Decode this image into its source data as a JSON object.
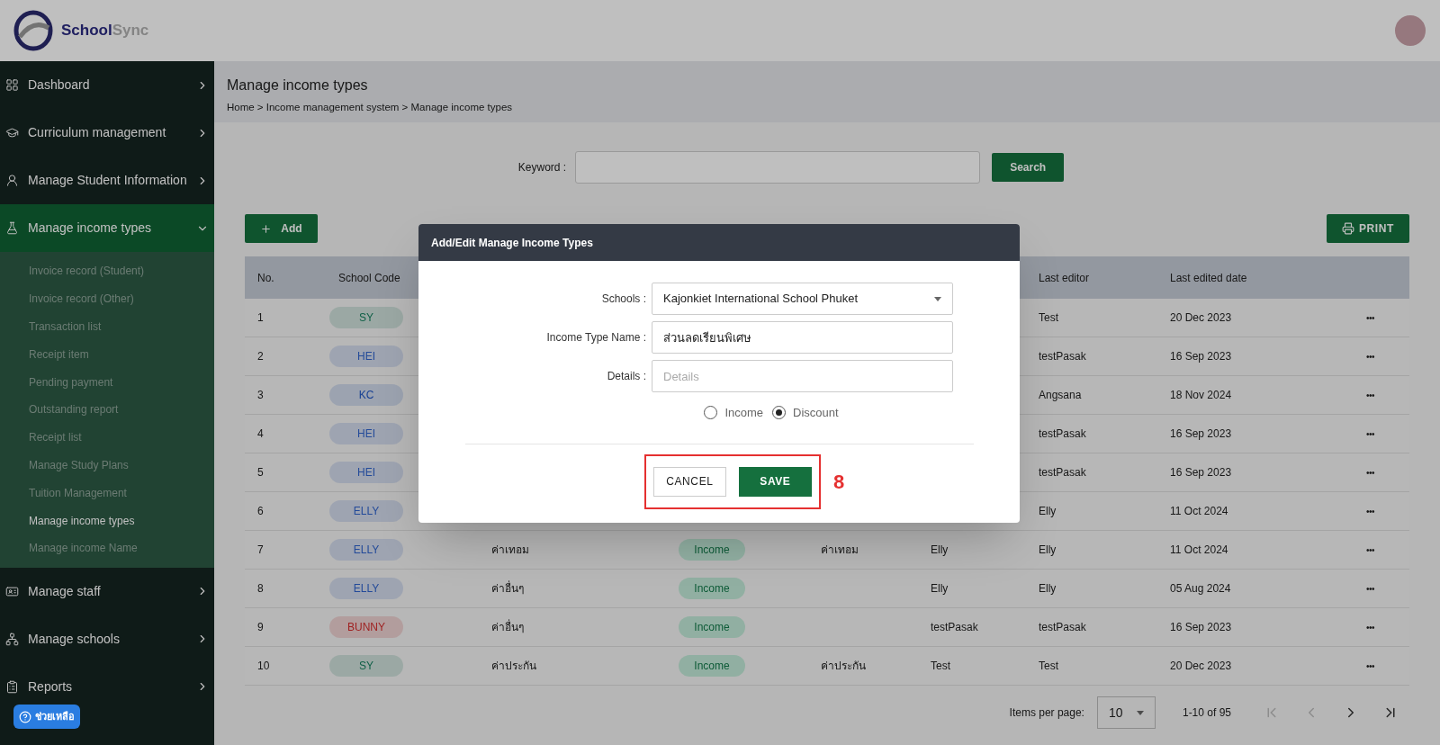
{
  "brand": {
    "first": "School",
    "second": "Sync"
  },
  "sidebar": {
    "items": [
      {
        "label": "Dashboard",
        "selected": false,
        "expanded": false
      },
      {
        "label": "Curriculum management",
        "selected": false,
        "expanded": false
      },
      {
        "label": "Manage Student Information",
        "selected": false,
        "expanded": false
      },
      {
        "label": "Manage income types",
        "selected": true,
        "expanded": true,
        "children": [
          {
            "label": "Invoice record (Student)",
            "selected": false
          },
          {
            "label": "Invoice record (Other)",
            "selected": false
          },
          {
            "label": "Transaction list",
            "selected": false
          },
          {
            "label": "Receipt item",
            "selected": false
          },
          {
            "label": "Pending payment",
            "selected": false
          },
          {
            "label": "Outstanding report",
            "selected": false
          },
          {
            "label": "Receipt list",
            "selected": false
          },
          {
            "label": "Manage Study Plans",
            "selected": false
          },
          {
            "label": "Tuition Management",
            "selected": false
          },
          {
            "label": "Manage income types",
            "selected": true
          },
          {
            "label": "Manage income Name",
            "selected": false
          }
        ]
      },
      {
        "label": "Manage staff",
        "selected": false,
        "expanded": false
      },
      {
        "label": "Manage schools",
        "selected": false,
        "expanded": false
      },
      {
        "label": "Reports",
        "selected": false,
        "expanded": false
      }
    ]
  },
  "help_button": {
    "label": "ช่วยเหลือ"
  },
  "page": {
    "title": "Manage income types",
    "breadcrumb": "Home > Income management system > Manage income types"
  },
  "search": {
    "label": "Keyword :",
    "button": "Search"
  },
  "add_button": "Add",
  "print_button": "PRINT",
  "table": {
    "columns": [
      "No.",
      "School Code",
      "",
      "",
      "",
      "",
      "Last editor",
      "Last edited date"
    ],
    "rows": [
      {
        "no": "1",
        "code": {
          "text": "SY",
          "color": "#106047"
        },
        "editor": "Test",
        "date": "20 Dec 2023",
        "actions": "•••"
      },
      {
        "no": "2",
        "code": {
          "text": "HEI",
          "color": "#234a99"
        },
        "editor": "testPasak",
        "date": "16 Sep 2023",
        "actions": "•••"
      },
      {
        "no": "3",
        "code": {
          "text": "KC",
          "color": "#174093"
        },
        "editor": "Angsana",
        "date": "18 Nov 2024",
        "actions": "•••"
      },
      {
        "no": "4",
        "code": {
          "text": "HEI",
          "color": "#234a99"
        },
        "editor": "testPasak",
        "date": "16 Sep 2023",
        "actions": "•••"
      },
      {
        "no": "5",
        "code": {
          "text": "HEI",
          "color": "#234a99"
        },
        "editor": "testPasak",
        "date": "16 Sep 2023",
        "actions": "•••"
      },
      {
        "no": "6",
        "code": {
          "text": "ELLY",
          "color": "#234a99"
        },
        "editor": "Elly",
        "date": "11 Oct 2024",
        "actions": "•••"
      },
      {
        "no": "7",
        "code": {
          "text": "ELLY",
          "color": "#234a99"
        },
        "column_3": "ค่าเทอม",
        "column_4": "Income",
        "column_5": "ค่าเทอม",
        "column_6": "Elly",
        "editor": "Elly",
        "date": "11 Oct 2024",
        "actions": "•••"
      },
      {
        "no": "8",
        "code": {
          "text": "ELLY",
          "color": "#234a99"
        },
        "column_3": "ค่าอื่นๆ",
        "column_4": "Income",
        "column_6": "Elly",
        "editor": "Elly",
        "date": "05 Aug 2024",
        "actions": "•••"
      },
      {
        "no": "9",
        "code": {
          "text": "BUNNY",
          "color": "#9f2020"
        },
        "column_3": "ค่าอื่นๆ",
        "column_4": "Income",
        "column_6": "testPasak",
        "editor": "testPasak",
        "date": "16 Sep 2023",
        "actions": "•••"
      },
      {
        "no": "10",
        "code": {
          "text": "SY",
          "color": "#106047"
        },
        "column_3": "ค่าประกัน",
        "column_4": "Income",
        "column_5": "ค่าประกัน",
        "column_6": "Test",
        "editor": "Test",
        "date": "20 Dec 2023",
        "actions": "•••"
      }
    ]
  },
  "pagination": {
    "label": "Items per page:",
    "page_size": "10",
    "range": "1-10 of 95",
    "first_disabled": true,
    "prev_disabled": true,
    "next_disabled": false,
    "last_disabled": false
  },
  "dialog": {
    "title": "Add/Edit Manage Income Types",
    "fields": [
      {
        "kind": "select",
        "label": "Schools :",
        "value": "Kajonkiet International School Phuket"
      },
      {
        "kind": "text",
        "label": "Income Type Name :",
        "value": "ส่วนลดเรียนพิเศษ"
      },
      {
        "kind": "text",
        "label": "Details :",
        "placeholder": "Details"
      }
    ],
    "options": [
      {
        "label": "Income",
        "selected": false
      },
      {
        "label": "Discount",
        "selected": true
      }
    ],
    "cancel": "CANCEL",
    "save": "SAVE"
  },
  "annotation": {
    "label": "8"
  }
}
